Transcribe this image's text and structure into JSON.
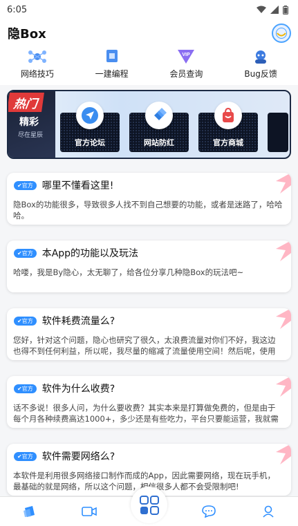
{
  "status": {
    "time": "6:05"
  },
  "app": {
    "title": "隐Box"
  },
  "quick": [
    {
      "label": "网络技巧",
      "icon": "network-icon"
    },
    {
      "label": "一建编程",
      "icon": "cube-icon"
    },
    {
      "label": "会员查询",
      "icon": "vip-icon"
    },
    {
      "label": "Bug反馈",
      "icon": "bug-feedback-icon"
    }
  ],
  "banner": {
    "tag": "热门",
    "title": "精彩",
    "subtitle": "尽在星辰",
    "cards": [
      {
        "label": "官方论坛",
        "icon": "send-icon"
      },
      {
        "label": "网站防红",
        "icon": "diamond-icon"
      },
      {
        "label": "官方商城",
        "icon": "shopping-bag-icon"
      }
    ]
  },
  "posts": [
    {
      "badge": "官方",
      "title": "哪里不懂看这里!",
      "body": "隐Box的功能很多，导致很多人找不到自己想要的功能，或者是迷路了，哈哈哈。"
    },
    {
      "badge": "官方",
      "title": "本App的功能以及玩法",
      "body": "哈喽，我是By隐心，太无聊了，给各位分享几种隐Box的玩法吧~"
    },
    {
      "badge": "官方",
      "title": "软件耗费流量么?",
      "body": "您好，针对这个问题，隐心也研究了很久，太浪费流量对你们不好，我这边也得不到任何利益，所以呢，我尽量的缩减了流量使用空间！然后呢，使用"
    },
    {
      "badge": "官方",
      "title": "软件为什么收费?",
      "body": "话不多说！很多人问，为什么要收费？其实本来是打算做免费的，但是由于每个月各种续费高达1000+，多少还是有些吃力，平台只要能运营，我就需要"
    },
    {
      "badge": "官方",
      "title": "软件需要网络么?",
      "body": "本软件是利用很多网络接口制作而成的App，因此需要网络，现在玩手机，最基础的就是网络，所以这个问题，相信很多人都不会受限制吧!"
    }
  ],
  "colors": {
    "accent": "#2f8fff",
    "hot": "#e03a3a",
    "banner_dark": "#1a2236"
  }
}
